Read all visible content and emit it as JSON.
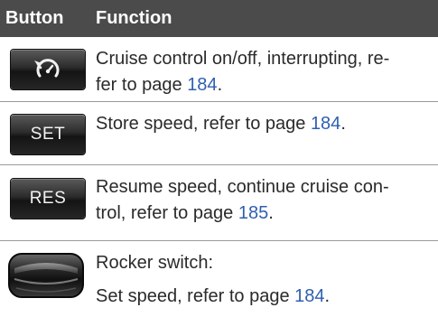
{
  "header": {
    "button": "Button",
    "function": "Function"
  },
  "rows": [
    {
      "icon": "cruise-control-icon",
      "text_before": "Cruise control on/off, interrupting, re-",
      "text_line2": "fer to page ",
      "page": "184",
      "text_after": "."
    },
    {
      "icon": "set-icon",
      "button_label": "SET",
      "text_before": "Store speed, refer to page ",
      "page": "184",
      "text_after": "."
    },
    {
      "icon": "res-icon",
      "button_label": "RES",
      "text_before": "Resume speed, continue cruise con-",
      "text_line2": "trol, refer to page ",
      "page": "185",
      "text_after": "."
    },
    {
      "icon": "rocker-switch-icon",
      "title": "Rocker switch:",
      "text_before": "Set speed, refer to page ",
      "page": "184",
      "text_after": "."
    }
  ],
  "colors": {
    "header_bg": "#4b4b4b",
    "link": "#2f5fb0",
    "divider": "#9a9a9a"
  }
}
